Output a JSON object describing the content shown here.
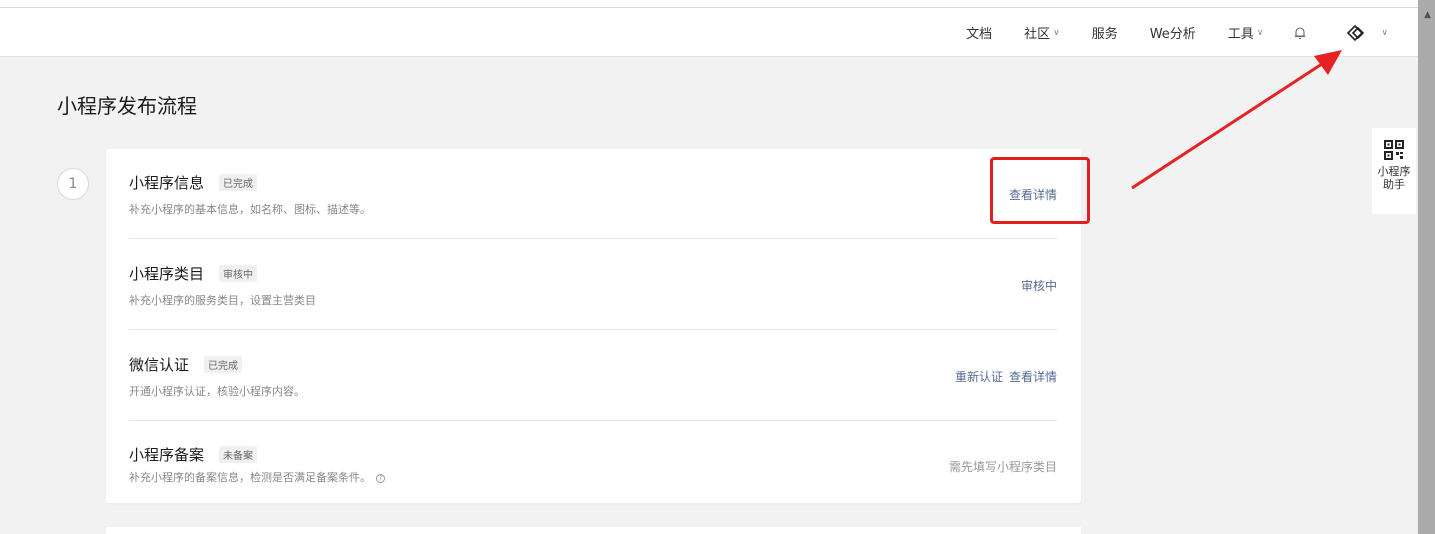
{
  "nav": {
    "items": [
      {
        "label": "文档"
      },
      {
        "label": "社区"
      },
      {
        "label": "服务"
      },
      {
        "label": "We分析"
      },
      {
        "label": "工具"
      }
    ]
  },
  "page": {
    "title": "小程序发布流程",
    "step_number": "1"
  },
  "rows": [
    {
      "title": "小程序信息",
      "badge": "已完成",
      "desc": "补充小程序的基本信息，如名称、图标、描述等。",
      "actions": [
        "查看详情"
      ]
    },
    {
      "title": "小程序类目",
      "badge": "审核中",
      "desc": "补充小程序的服务类目，设置主营类目",
      "actions": [
        "审核中"
      ]
    },
    {
      "title": "微信认证",
      "badge": "已完成",
      "desc": "开通小程序认证，核验小程序内容。",
      "actions": [
        "重新认证",
        "查看详情"
      ]
    },
    {
      "title": "小程序备案",
      "badge": "未备案",
      "desc": "补充小程序的备案信息，检测是否满足备案条件。",
      "actions": [
        "需先填写小程序类目"
      ]
    }
  ],
  "side_widget": {
    "line1": "小程序",
    "line2": "助手"
  },
  "colors": {
    "link": "#576b95",
    "highlight": "#e02020",
    "bg": "#f2f2f2"
  }
}
